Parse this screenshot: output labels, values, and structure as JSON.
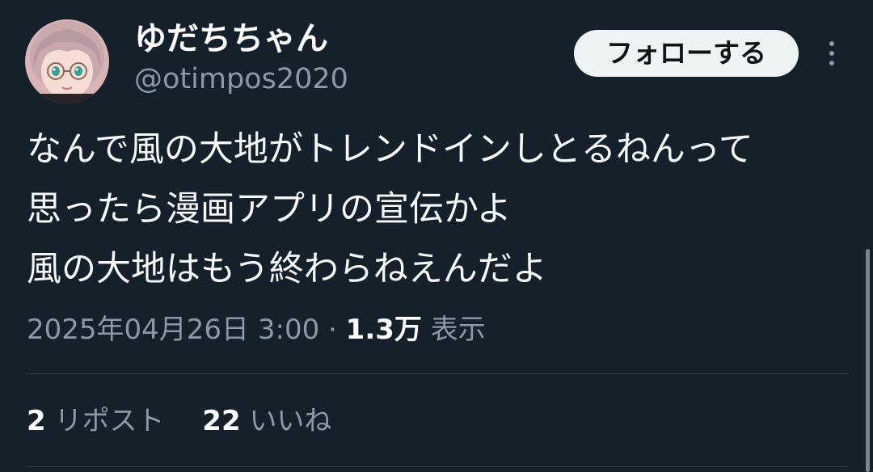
{
  "user": {
    "display_name": "ゆだちちゃん",
    "handle": "@otimpos2020"
  },
  "header": {
    "follow_label": "フォローする",
    "more_icon": "vertical-ellipsis-icon"
  },
  "tweet": {
    "lines": [
      "なんで風の大地がトレンドインしとるねんって",
      "思ったら漫画アプリの宣伝かよ",
      "風の大地はもう終わらねえんだよ"
    ],
    "date": "2025年04月26日",
    "time": "3:00",
    "separator": "·",
    "views_count": "1.3万",
    "views_label": "表示"
  },
  "stats": {
    "reposts_count": "2",
    "reposts_label": "リポスト",
    "likes_count": "22",
    "likes_label": "いいね"
  },
  "colors": {
    "background": "#15202b",
    "primary_text": "#f7f9f9",
    "secondary_text": "#8b98a5",
    "divider": "#38444d",
    "follow_button_bg": "#eff3f4"
  }
}
